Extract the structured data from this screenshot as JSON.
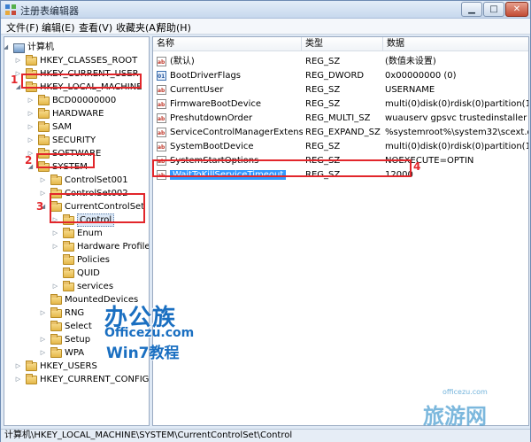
{
  "window": {
    "title": "注册表编辑器"
  },
  "menu": [
    "文件(F)",
    "编辑(E)",
    "查看(V)",
    "收藏夹(A)",
    "帮助(H)"
  ],
  "tree": [
    {
      "label": "计算机",
      "icon": "computer-icon",
      "expander": "open"
    },
    {
      "label": "HKEY_CLASSES_ROOT",
      "icon": "folder-icon",
      "expander": "closed"
    },
    {
      "label": "HKEY_CURRENT_USER",
      "icon": "folder-icon",
      "expander": "closed"
    },
    {
      "label": "HKEY_LOCAL_MACHINE",
      "icon": "folder-icon",
      "expander": "open"
    },
    {
      "label": "BCD00000000",
      "icon": "folder-icon",
      "expander": "closed"
    },
    {
      "label": "HARDWARE",
      "icon": "folder-icon",
      "expander": "closed"
    },
    {
      "label": "SAM",
      "icon": "folder-icon",
      "expander": "closed"
    },
    {
      "label": "SECURITY",
      "icon": "folder-icon",
      "expander": "closed"
    },
    {
      "label": "SOFTWARE",
      "icon": "folder-icon",
      "expander": "closed"
    },
    {
      "label": "SYSTEM",
      "icon": "folder-icon",
      "expander": "open"
    },
    {
      "label": "ControlSet001",
      "icon": "folder-icon",
      "expander": "closed"
    },
    {
      "label": "ControlSet002",
      "icon": "folder-icon",
      "expander": "closed"
    },
    {
      "label": "CurrentControlSet",
      "icon": "folder-icon",
      "expander": "open"
    },
    {
      "label": "Control",
      "icon": "folder-icon",
      "expander": "closed",
      "selected": true
    },
    {
      "label": "Enum",
      "icon": "folder-icon",
      "expander": "closed"
    },
    {
      "label": "Hardware Profile",
      "icon": "folder-icon",
      "expander": "closed"
    },
    {
      "label": "Policies",
      "icon": "folder-icon",
      "expander": "none"
    },
    {
      "label": "QUID",
      "icon": "folder-icon",
      "expander": "none"
    },
    {
      "label": "services",
      "icon": "folder-icon",
      "expander": "closed"
    },
    {
      "label": "MountedDevices",
      "icon": "folder-icon",
      "expander": "none"
    },
    {
      "label": "RNG",
      "icon": "folder-icon",
      "expander": "closed"
    },
    {
      "label": "Select",
      "icon": "folder-icon",
      "expander": "none"
    },
    {
      "label": "Setup",
      "icon": "folder-icon",
      "expander": "closed"
    },
    {
      "label": "WPA",
      "icon": "folder-icon",
      "expander": "closed"
    },
    {
      "label": "HKEY_USERS",
      "icon": "folder-icon",
      "expander": "closed"
    },
    {
      "label": "HKEY_CURRENT_CONFIG",
      "icon": "folder-icon",
      "expander": "closed"
    }
  ],
  "columns": {
    "name": "名称",
    "type": "类型",
    "data": "数据"
  },
  "values": [
    {
      "name": "(默认)",
      "type": "REG_SZ",
      "data": "(数值未设置)",
      "icon": "string-value-icon"
    },
    {
      "name": "BootDriverFlags",
      "type": "REG_DWORD",
      "data": "0x00000000 (0)",
      "icon": "binary-value-icon"
    },
    {
      "name": "CurrentUser",
      "type": "REG_SZ",
      "data": "USERNAME",
      "icon": "string-value-icon"
    },
    {
      "name": "FirmwareBootDevice",
      "type": "REG_SZ",
      "data": "multi(0)disk(0)rdisk(0)partition(1)",
      "icon": "string-value-icon"
    },
    {
      "name": "PreshutdownOrder",
      "type": "REG_MULTI_SZ",
      "data": "wuauserv gpsvc trustedinstaller",
      "icon": "string-value-icon"
    },
    {
      "name": "ServiceControlManagerExtension",
      "type": "REG_EXPAND_SZ",
      "data": "%systemroot%\\system32\\scext.dll",
      "icon": "string-value-icon"
    },
    {
      "name": "SystemBootDevice",
      "type": "REG_SZ",
      "data": "multi(0)disk(0)rdisk(0)partition(1)",
      "icon": "string-value-icon"
    },
    {
      "name": "SystemStartOptions",
      "type": "REG_SZ",
      "data": " NOEXECUTE=OPTIN",
      "icon": "string-value-icon"
    },
    {
      "name": "WaitToKillServiceTimeout",
      "type": "REG_SZ",
      "data": "12000",
      "icon": "string-value-icon",
      "selected": true
    }
  ],
  "status": "计算机\\HKEY_LOCAL_MACHINE\\SYSTEM\\CurrentControlSet\\Control",
  "markers": [
    "1",
    "2",
    "3",
    "4"
  ],
  "watermark": {
    "brand": "办公族",
    "site": "Officezu.com",
    "series": "Win7教程",
    "corner": "旅游网",
    "corner_small": "officezu.com"
  }
}
